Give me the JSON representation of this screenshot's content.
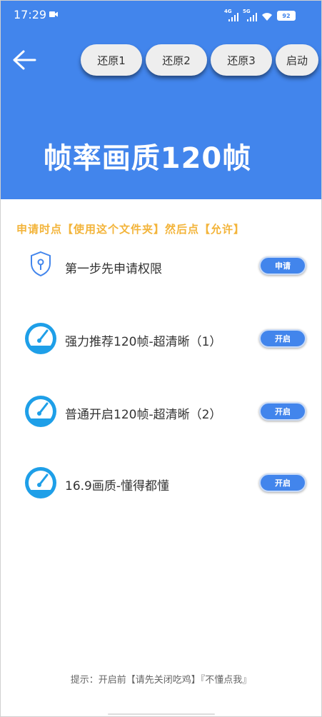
{
  "status_bar": {
    "time": "17:29",
    "net1": "4G",
    "net2": "5G",
    "battery": "92"
  },
  "toolbar": {
    "restore1": "还原1",
    "restore2": "还原2",
    "restore3": "还原3",
    "start": "启动"
  },
  "title": "帧率画质120帧",
  "notice": "申请时点【使用这个文件夹】然后点【允许】",
  "rows": [
    {
      "label": "第一步先申请权限",
      "button": "申请",
      "icon": "shield-key-icon"
    },
    {
      "label": "强力推荐120帧-超清晰（1）",
      "button": "开启",
      "icon": "speedometer-icon"
    },
    {
      "label": "普通开启120帧-超清晰（2）",
      "button": "开启",
      "icon": "speedometer-icon"
    },
    {
      "label": "16.9画质-懂得都懂",
      "button": "开启",
      "icon": "speedometer-icon"
    }
  ],
  "hint": "提示：开启前【请先关闭吃鸡】『不懂点我』",
  "colors": {
    "accent": "#4285ec",
    "notice": "#f3b43a"
  }
}
